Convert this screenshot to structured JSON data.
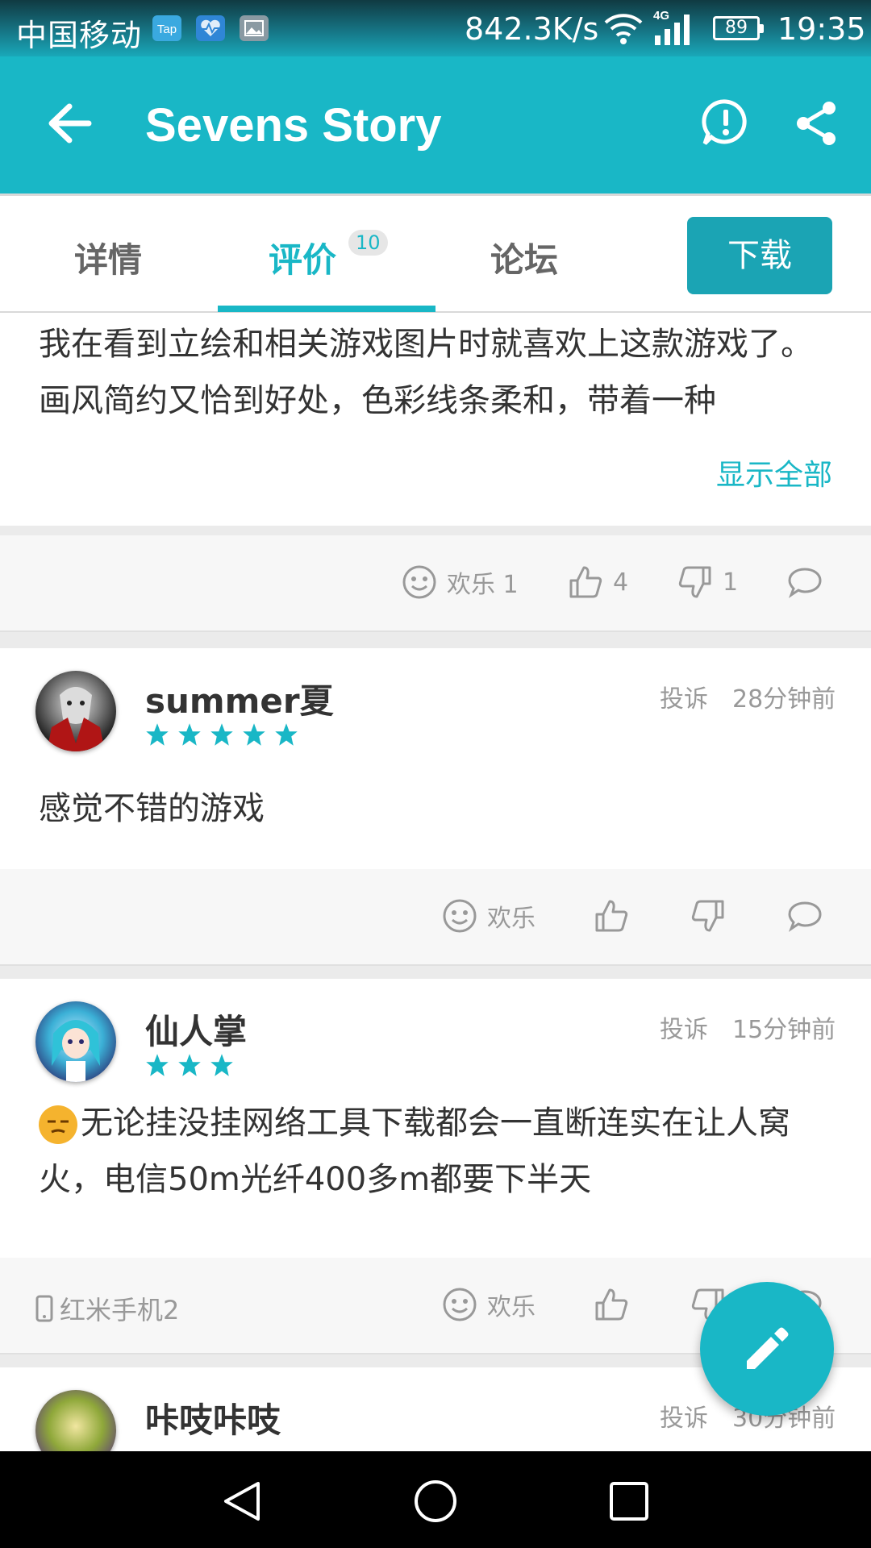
{
  "status_bar": {
    "carrier": "中国移动",
    "notification_icons": [
      "tap-icon",
      "health-icon",
      "gallery-icon"
    ],
    "tap_label": "Tap",
    "network_speed": "842.3K/s",
    "network_type": "4G",
    "battery": "89",
    "time": "19:35"
  },
  "app_bar": {
    "title": "Sevens Story"
  },
  "tabs": {
    "items": [
      {
        "label": "详情"
      },
      {
        "label": "评价",
        "badge": "10",
        "active": true
      },
      {
        "label": "论坛"
      }
    ],
    "download_label": "下载"
  },
  "reviews": [
    {
      "text": "我在看到立绘和相关游戏图片时就喜欢上这款游戏了。画风简约又恰到好处，色彩线条柔和，带着一种",
      "show_all_label": "显示全部",
      "fun_label": "欢乐 1",
      "likes": "4",
      "dislikes": "1"
    },
    {
      "username": "summer夏",
      "rating": 5,
      "report_label": "投诉",
      "time": "28分钟前",
      "text": "感觉不错的游戏",
      "fun_label": "欢乐"
    },
    {
      "username": "仙人掌",
      "rating": 3,
      "report_label": "投诉",
      "time": "15分钟前",
      "text": "无论挂没挂网络工具下载都会一直断连实在让人窝火，电信50m光纤400多m都要下半天",
      "device": "红米手机2",
      "fun_label": "欢乐"
    },
    {
      "username": "咔吱咔吱",
      "report_label": "投诉",
      "time": "30分钟前"
    }
  ],
  "colors": {
    "accent": "#19b7c6",
    "download_button": "#1ba4b4",
    "star": "#19b7c6",
    "muted_text": "#999999"
  },
  "icons": {
    "app_bar": [
      "back-arrow-icon",
      "report-icon",
      "share-icon"
    ],
    "actions": [
      "smiley-icon",
      "thumbs-up-icon",
      "thumbs-down-icon",
      "comment-icon"
    ],
    "fab": "edit-pencil-icon",
    "nav": [
      "nav-back-icon",
      "nav-home-icon",
      "nav-recents-icon"
    ]
  }
}
